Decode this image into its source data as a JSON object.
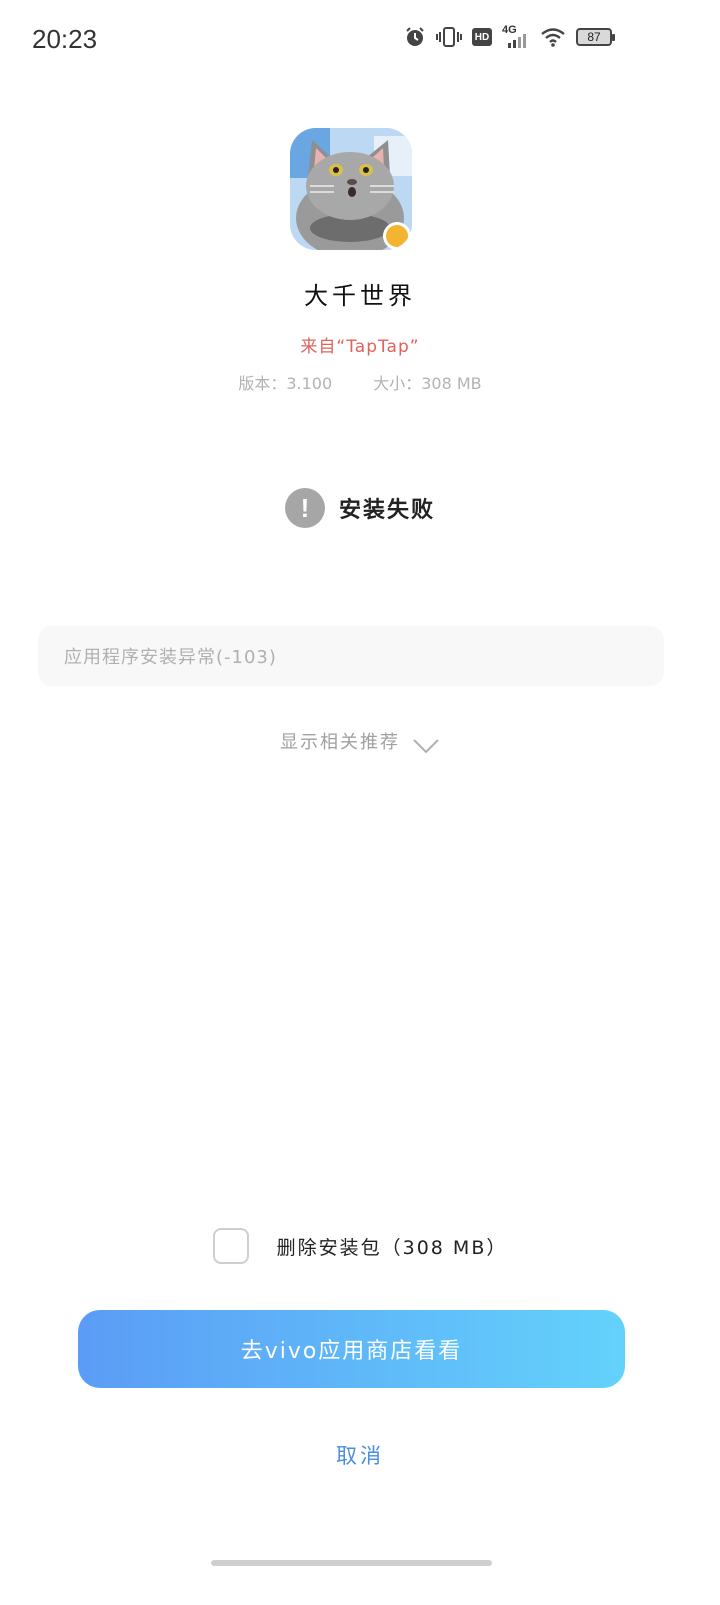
{
  "status_bar": {
    "time": "20:23",
    "icons": [
      "alarm-icon",
      "vibrate-icon",
      "hd-icon",
      "signal-4g-icon",
      "wifi-icon",
      "battery-icon"
    ],
    "hd_label": "HD",
    "network_label": "4G",
    "battery_level": "87"
  },
  "app": {
    "name": "大千世界",
    "source": "来自“TapTap”",
    "version": "版本：3.100",
    "size": "大小：308 MB"
  },
  "install_status": {
    "icon": "exclamation-icon",
    "icon_glyph": "!",
    "text": "安装失败",
    "color": "#a6a6a6"
  },
  "error_message": "应用程序安装异常(-103)",
  "recommend_label": "显示相关推荐",
  "delete_option": {
    "label": "删除安装包（308 MB）",
    "checked": false
  },
  "primary_button": {
    "label": "去vivo应用商店看看",
    "gradient": [
      "#5b9cf6",
      "#63d2fb"
    ]
  },
  "cancel_label": "取消",
  "colors": {
    "source_red": "#e0625a",
    "link_blue": "#4b8de0"
  }
}
